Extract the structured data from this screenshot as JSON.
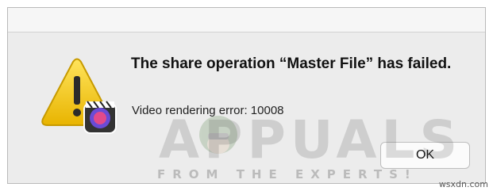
{
  "dialog": {
    "headline": "The share operation “Master File” has failed.",
    "detail": "Video rendering error: 10008",
    "ok_label": "OK",
    "icon": "alert-icon"
  },
  "watermark": {
    "brand": "APPUALS",
    "tagline": "FROM THE EXPERTS!"
  },
  "footer": {
    "site": "wsxdn.com"
  },
  "colors": {
    "warning_yellow": "#f2c200",
    "dialog_bg": "#ececec"
  }
}
